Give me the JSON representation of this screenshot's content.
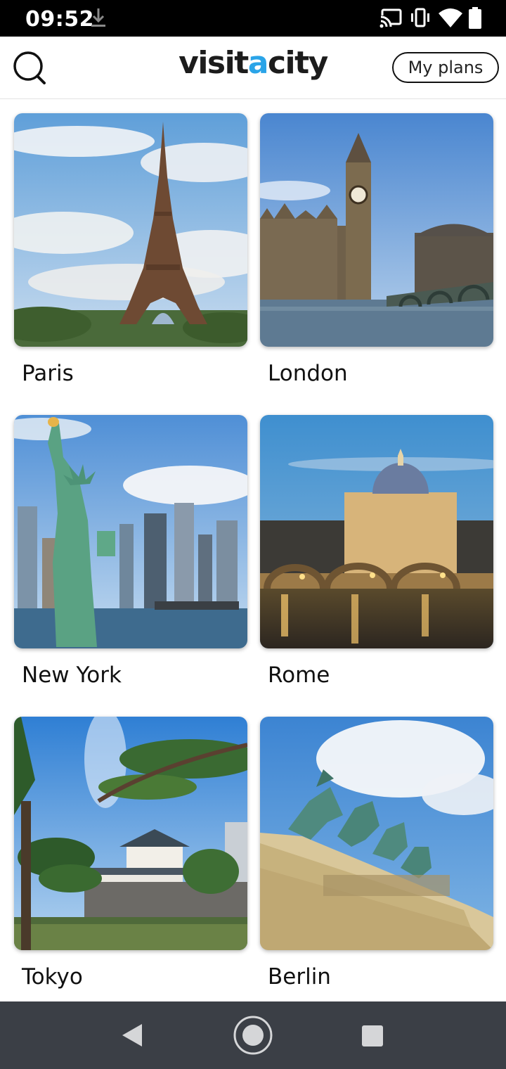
{
  "status_bar": {
    "time": "09:52",
    "icons": [
      "download-icon",
      "cast-icon",
      "vibrate-icon",
      "wifi-icon",
      "battery-icon"
    ]
  },
  "header": {
    "logo_part1": "visit",
    "logo_accent": "a",
    "logo_part2": "city",
    "my_plans_label": "My plans",
    "search_icon": "search-icon",
    "accent_color": "#2aa4e8"
  },
  "cities": [
    {
      "name": "Paris"
    },
    {
      "name": "London"
    },
    {
      "name": "New York"
    },
    {
      "name": "Rome"
    },
    {
      "name": "Tokyo"
    },
    {
      "name": "Berlin"
    }
  ],
  "nav_bar": {
    "back_icon": "back-icon",
    "home_icon": "home-icon",
    "recents_icon": "recents-icon"
  }
}
